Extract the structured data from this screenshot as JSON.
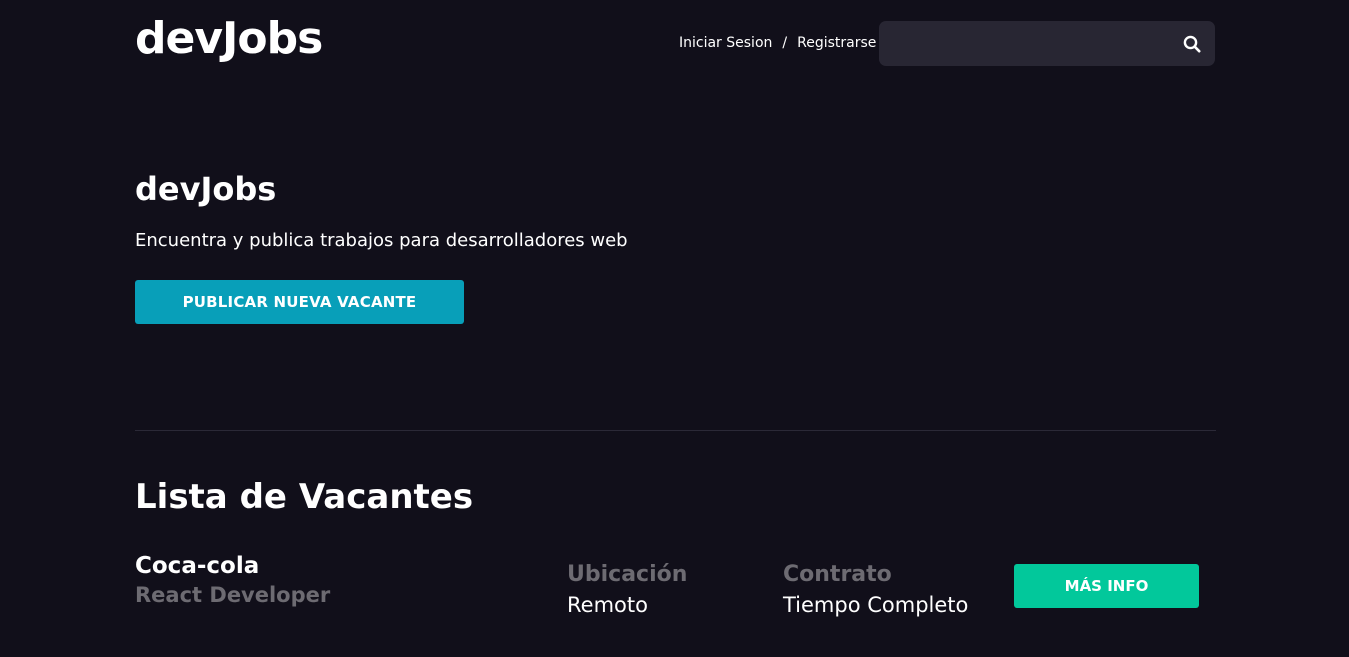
{
  "header": {
    "logo": "devJobs",
    "login_label": "Iniciar Sesion",
    "separator": "/",
    "register_label": "Registrarse",
    "search": {
      "value": "",
      "placeholder": "",
      "icon": "search-icon"
    }
  },
  "hero": {
    "title": "devJobs",
    "subtitle": "Encuentra y publica trabajos para desarrolladores web",
    "publish_button": "PUBLICAR NUEVA VACANTE"
  },
  "vacancies": {
    "title": "Lista de Vacantes",
    "items": [
      {
        "company": "Coca-cola",
        "role": "React Developer",
        "location_label": "Ubicación",
        "location": "Remoto",
        "contract_label": "Contrato",
        "contract": "Tiempo Completo",
        "more_button": "MÁS INFO"
      }
    ]
  },
  "colors": {
    "background": "#110f1a",
    "search_bg": "#282633",
    "primary_button": "#089fb9",
    "more_button": "#02c89b",
    "muted_text": "#6d6b72"
  }
}
